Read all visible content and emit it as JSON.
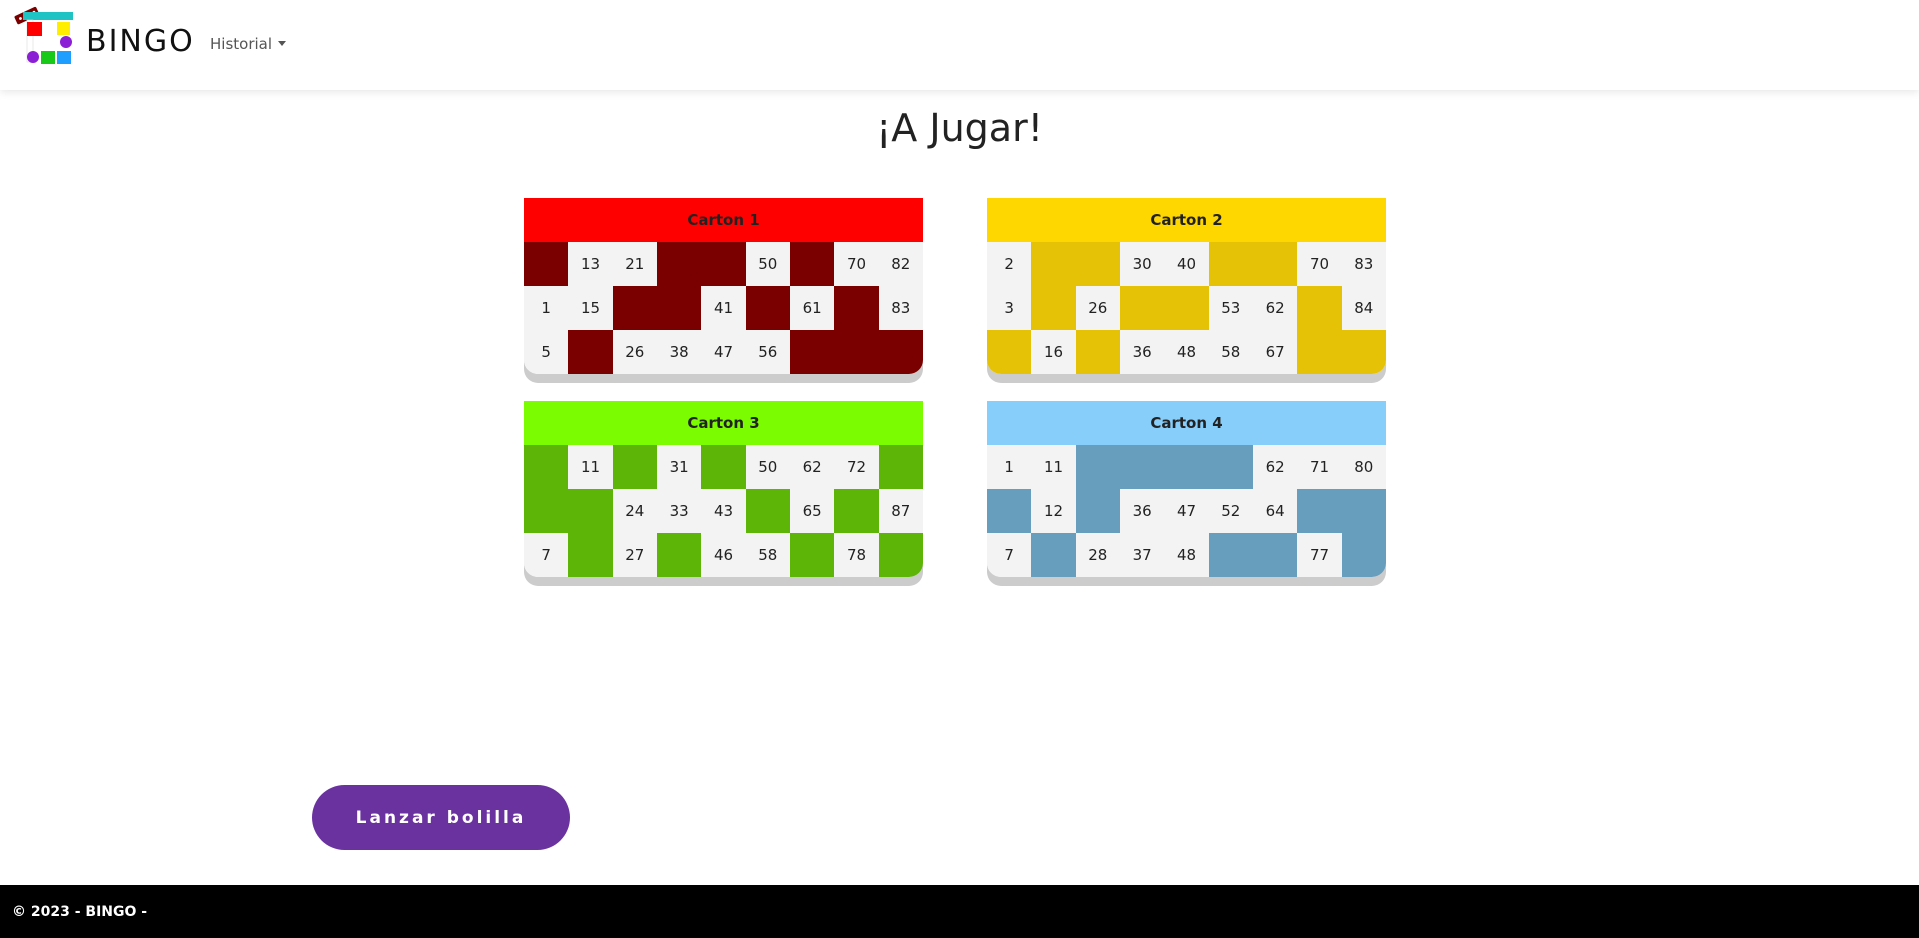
{
  "navbar": {
    "brand": "BINGO",
    "menu": {
      "historial": "Historial"
    }
  },
  "colors": {
    "carton_1": {
      "header": "#ff0000",
      "cell": "#7a0000"
    },
    "carton_2": {
      "header": "#ffd700",
      "cell": "#e6c207"
    },
    "carton_3": {
      "header": "#7cfc00",
      "cell": "#5cb507"
    },
    "carton_4": {
      "header": "#87cefa",
      "cell": "#679ebe"
    },
    "play_button": "#6a329f",
    "footer": "#000000"
  },
  "main": {
    "title": "¡A Jugar!",
    "cartones": [
      {
        "label": "Carton 1",
        "rows": [
          [
            "",
            "13",
            "21",
            "",
            "",
            "50",
            "",
            "70",
            "82"
          ],
          [
            "1",
            "15",
            "",
            "",
            "41",
            "",
            "61",
            "",
            "83"
          ],
          [
            "5",
            "",
            "26",
            "38",
            "47",
            "56",
            "",
            "",
            ""
          ]
        ]
      },
      {
        "label": "Carton 2",
        "rows": [
          [
            "2",
            "",
            "",
            "30",
            "40",
            "",
            "",
            "70",
            "83"
          ],
          [
            "3",
            "",
            "26",
            "",
            "",
            "53",
            "62",
            "",
            "84"
          ],
          [
            "",
            "16",
            "",
            "36",
            "48",
            "58",
            "67",
            "",
            ""
          ]
        ]
      },
      {
        "label": "Carton 3",
        "rows": [
          [
            "",
            "11",
            "",
            "31",
            "",
            "50",
            "62",
            "72",
            ""
          ],
          [
            "",
            "",
            "24",
            "33",
            "43",
            "",
            "65",
            "",
            "87"
          ],
          [
            "7",
            "",
            "27",
            "",
            "46",
            "58",
            "",
            "78",
            ""
          ]
        ]
      },
      {
        "label": "Carton 4",
        "rows": [
          [
            "1",
            "11",
            "",
            "",
            "",
            "",
            "62",
            "71",
            "80"
          ],
          [
            "",
            "12",
            "",
            "36",
            "47",
            "52",
            "64",
            "",
            ""
          ],
          [
            "7",
            "",
            "28",
            "37",
            "48",
            "",
            "",
            "77",
            ""
          ]
        ]
      }
    ],
    "play_button": "Lanzar bolilla"
  },
  "footer": {
    "text": "© 2023 - BINGO -"
  }
}
